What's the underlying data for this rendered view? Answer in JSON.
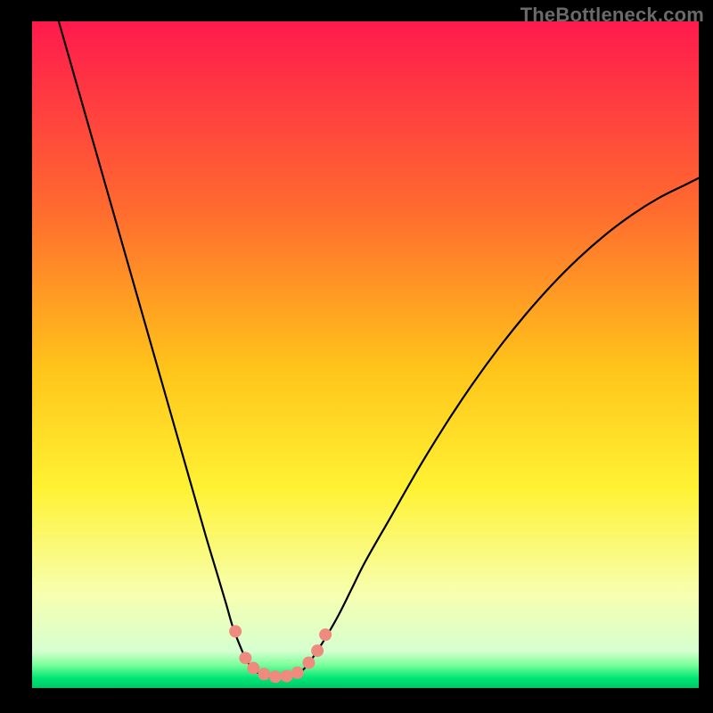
{
  "watermark": "TheBottleneck.com",
  "chart_data": {
    "type": "line",
    "title": "",
    "xlabel": "",
    "ylabel": "",
    "xlim": [
      0,
      100
    ],
    "ylim": [
      0,
      100
    ],
    "gradient": [
      {
        "stop": 0,
        "color": "#ff1a4d"
      },
      {
        "stop": 0.28,
        "color": "#ff6a2f"
      },
      {
        "stop": 0.52,
        "color": "#ffc41a"
      },
      {
        "stop": 0.7,
        "color": "#fff233"
      },
      {
        "stop": 0.86,
        "color": "#f7ffb0"
      },
      {
        "stop": 0.945,
        "color": "#d6ffd0"
      },
      {
        "stop": 0.965,
        "color": "#7cff9a"
      },
      {
        "stop": 0.985,
        "color": "#00e676"
      },
      {
        "stop": 1.0,
        "color": "#00c766"
      }
    ],
    "series": [
      {
        "name": "left-branch",
        "x": [
          4,
          6,
          8,
          10,
          12,
          14,
          16,
          18,
          20,
          22,
          24,
          26,
          27.5,
          29,
          30,
          31,
          32,
          33,
          34
        ],
        "y": [
          100,
          93,
          86,
          79,
          72,
          65,
          58,
          51,
          44,
          37,
          30,
          23,
          18,
          13,
          9.5,
          6.8,
          4.5,
          3.0,
          2.2
        ]
      },
      {
        "name": "valley",
        "x": [
          34,
          35,
          36,
          37,
          38,
          39,
          40
        ],
        "y": [
          2.2,
          1.8,
          1.6,
          1.55,
          1.6,
          1.8,
          2.2
        ]
      },
      {
        "name": "right-branch",
        "x": [
          40,
          41,
          42,
          44,
          46,
          48,
          50,
          54,
          58,
          62,
          66,
          70,
          74,
          78,
          82,
          86,
          90,
          94,
          98,
          100
        ],
        "y": [
          2.2,
          3.1,
          4.4,
          7.5,
          11,
          15,
          19,
          26,
          33,
          39.5,
          45.5,
          51,
          56,
          60.5,
          64.5,
          68,
          71,
          73.5,
          75.5,
          76.5
        ]
      }
    ],
    "markers": {
      "name": "highlight-dots",
      "color": "#ef8a7e",
      "radius": 7,
      "points": [
        {
          "x": 30.5,
          "y": 8.5
        },
        {
          "x": 32.0,
          "y": 4.5
        },
        {
          "x": 33.2,
          "y": 3.0
        },
        {
          "x": 34.8,
          "y": 2.1
        },
        {
          "x": 36.5,
          "y": 1.7
        },
        {
          "x": 38.2,
          "y": 1.8
        },
        {
          "x": 39.8,
          "y": 2.3
        },
        {
          "x": 41.5,
          "y": 3.8
        },
        {
          "x": 42.8,
          "y": 5.6
        },
        {
          "x": 44.0,
          "y": 8.0
        }
      ]
    }
  }
}
